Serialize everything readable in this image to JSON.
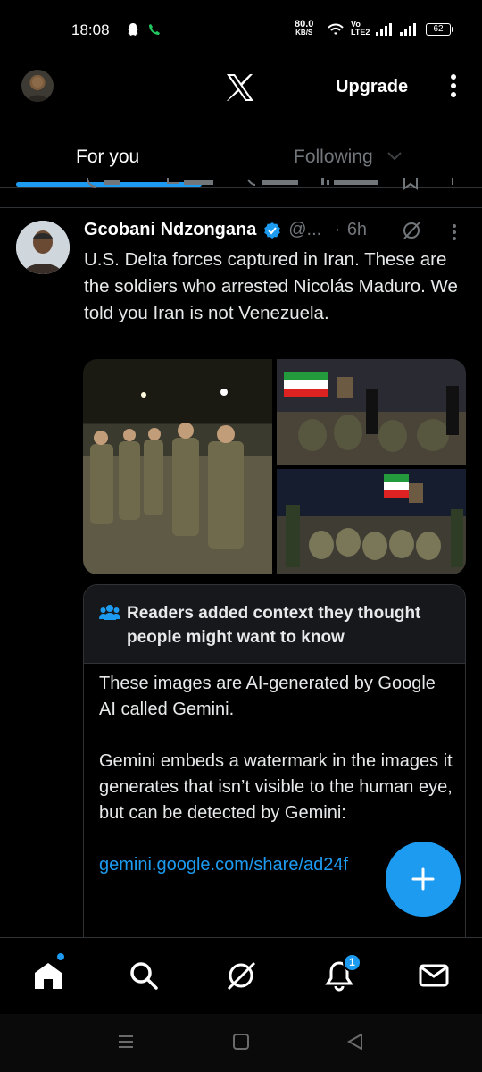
{
  "status_bar": {
    "time": "18:08",
    "net_speed": "80.0",
    "net_speed_unit": "KB/S",
    "volte_top": "Vo",
    "volte_bottom": "LTE2",
    "battery": "62"
  },
  "app_bar": {
    "upgrade_label": "Upgrade",
    "icons": [
      "x-logo-icon",
      "more-vertical-icon"
    ]
  },
  "tabs": [
    {
      "label": "For you",
      "active": true
    },
    {
      "label": "Following",
      "active": false
    }
  ],
  "tweet": {
    "author_name": "Gcobani Ndzongana",
    "handle": "@...",
    "separator": "·",
    "time": "6h",
    "text": "U.S. Delta forces captured in Iran. These are the soldiers who arrested Nicolás Maduro. We told you Iran is not Venezuela.",
    "media_count": 3
  },
  "community_note": {
    "title": "Readers added context they thought people might want to know",
    "paragraph_1": "These images are AI-generated by Google AI called Gemini.",
    "paragraph_2": "Gemini embeds a watermark in the images it generates that isn’t visible to the human eye, but can be detected by Gemini:",
    "link": "gemini.google.com/share/ad24f"
  },
  "bottom_nav": {
    "items": [
      "home-icon",
      "search-icon",
      "grok-icon",
      "notifications-icon",
      "messages-icon"
    ],
    "notification_count": "1",
    "accent": "#1d9bf0"
  },
  "colors": {
    "background": "#000000",
    "accent": "#1d9bf0",
    "muted": "#71767b",
    "divider": "#2f3336"
  }
}
